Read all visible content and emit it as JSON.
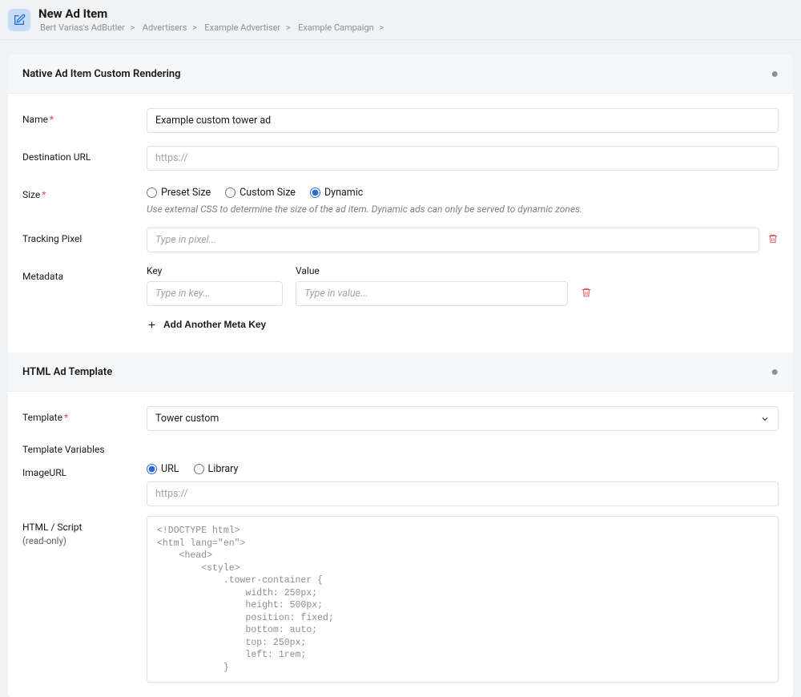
{
  "header": {
    "title": "New Ad Item",
    "breadcrumb": [
      "Bert Varias's AdButler",
      "Advertisers",
      "Example Advertiser",
      "Example Campaign"
    ]
  },
  "section1": {
    "title": "Native Ad Item Custom Rendering",
    "name_label": "Name",
    "name_value": "Example custom tower ad",
    "dest_label": "Destination URL",
    "dest_placeholder": "https://",
    "size_label": "Size",
    "size_opts": {
      "preset": "Preset Size",
      "custom": "Custom Size",
      "dynamic": "Dynamic"
    },
    "size_help": "Use external CSS to determine the size of the ad item. Dynamic ads can only be served to dynamic zones.",
    "pixel_label": "Tracking Pixel",
    "pixel_placeholder": "Type in pixel...",
    "meta_label": "Metadata",
    "meta_key": "Key",
    "meta_value": "Value",
    "meta_key_ph": "Type in key...",
    "meta_value_ph": "Type in value...",
    "add_meta": "Add Another Meta Key"
  },
  "section2": {
    "title": "HTML Ad Template",
    "template_label": "Template",
    "template_value": "Tower custom",
    "vars_label": "Template Variables",
    "imgurl_label": "ImageURL",
    "imgurl_opts": {
      "url": "URL",
      "library": "Library"
    },
    "imgurl_placeholder": "https://",
    "html_label": "HTML / Script",
    "html_sub": "(read-only)",
    "html_code": "<!DOCTYPE html>\n<html lang=\"en\">\n    <head>\n        <style>\n            .tower-container {\n                width: 250px;\n                height: 500px;\n                position: fixed;\n                bottom: auto;\n                top: 250px;\n                left: 1rem;\n            }"
  }
}
